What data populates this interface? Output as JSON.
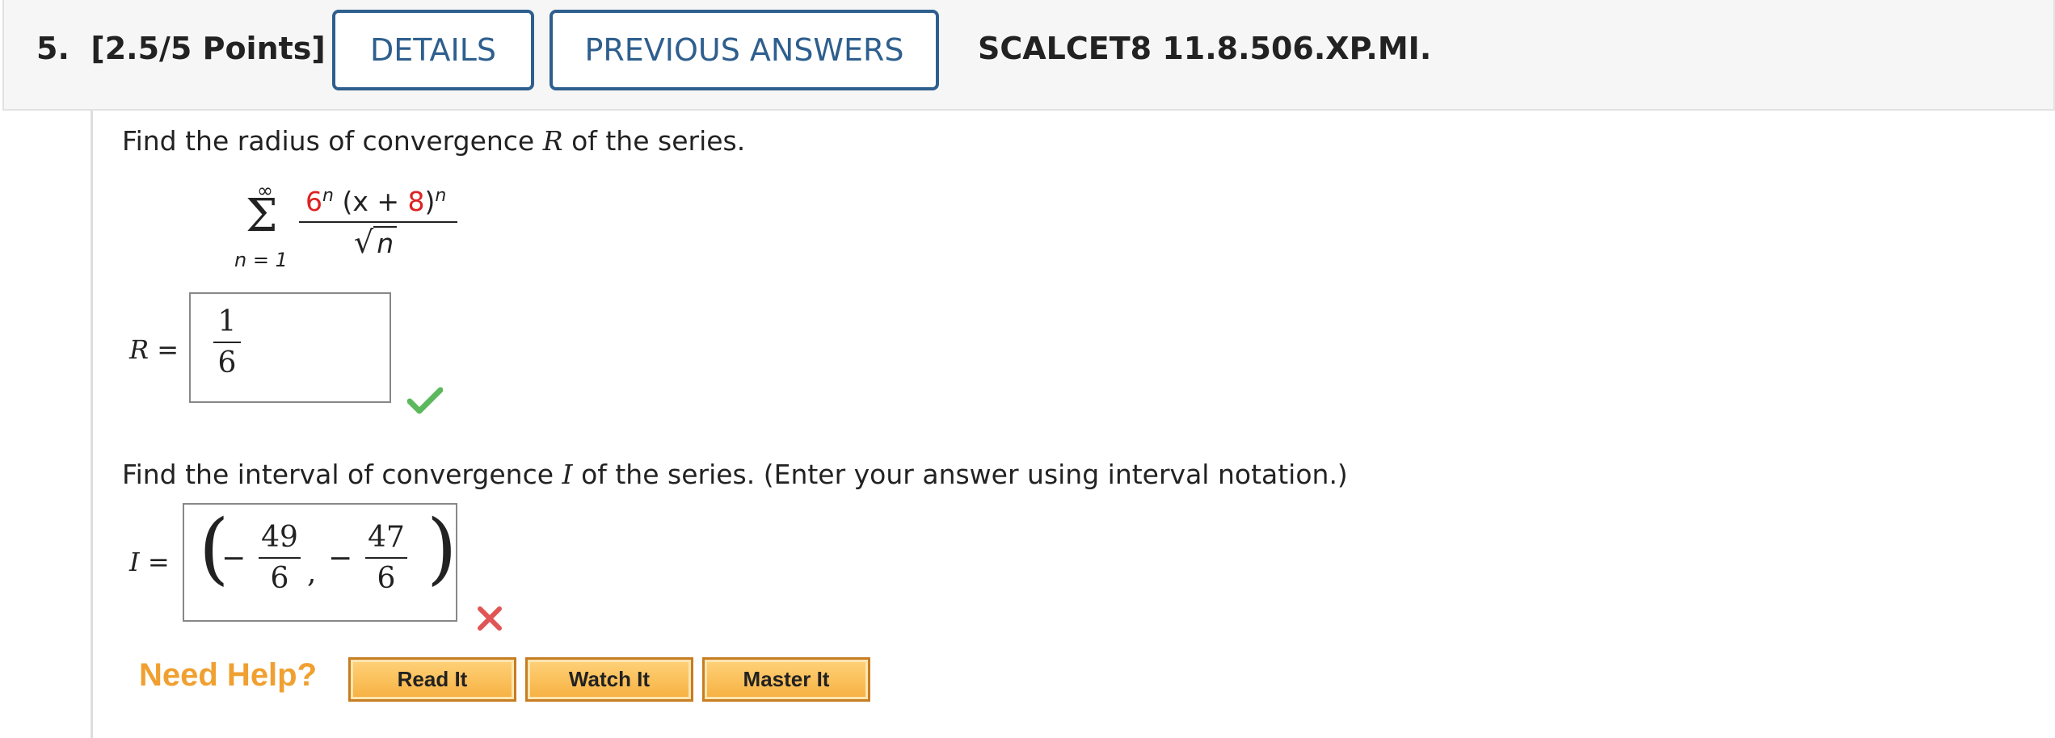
{
  "header": {
    "question_number": "5.",
    "points": "[2.5/5 Points]",
    "details_label": "DETAILS",
    "previous_answers_label": "PREVIOUS ANSWERS",
    "question_code": "SCALCET8 11.8.506.XP.MI."
  },
  "part1": {
    "prompt_before": "Find the radius of convergence ",
    "prompt_var": "R",
    "prompt_after": " of the series.",
    "series": {
      "upper_limit": "∞",
      "lower_limit": "n = 1",
      "numerator_base": "6",
      "numerator_exp": "n",
      "numerator_open": " (x + ",
      "numerator_const": "8",
      "numerator_close": ")",
      "numerator_exp2": "n",
      "denominator": "n"
    },
    "answer_label_var": "R",
    "answer_label_eq": " =",
    "answer": {
      "numerator": "1",
      "denominator": "6"
    },
    "status": "correct"
  },
  "part2": {
    "prompt_before": "Find the interval of convergence ",
    "prompt_var": "I",
    "prompt_after": " of the series. (Enter your answer using interval notation.)",
    "answer_label_var": "I",
    "answer_label_eq": " =",
    "answer": {
      "left_paren": "(",
      "right_paren": ")",
      "minus": "−",
      "comma": ",",
      "left": {
        "numerator": "49",
        "denominator": "6"
      },
      "right": {
        "numerator": "47",
        "denominator": "6"
      }
    },
    "status": "incorrect"
  },
  "help": {
    "title": "Need Help?",
    "buttons": [
      "Read It",
      "Watch It",
      "Master It"
    ]
  },
  "colors": {
    "header_blue": "#2e5f8e",
    "correct_green": "#5cb85c",
    "incorrect_red": "#e05555",
    "help_orange": "#f0a030",
    "highlight_red": "#dd2222"
  }
}
